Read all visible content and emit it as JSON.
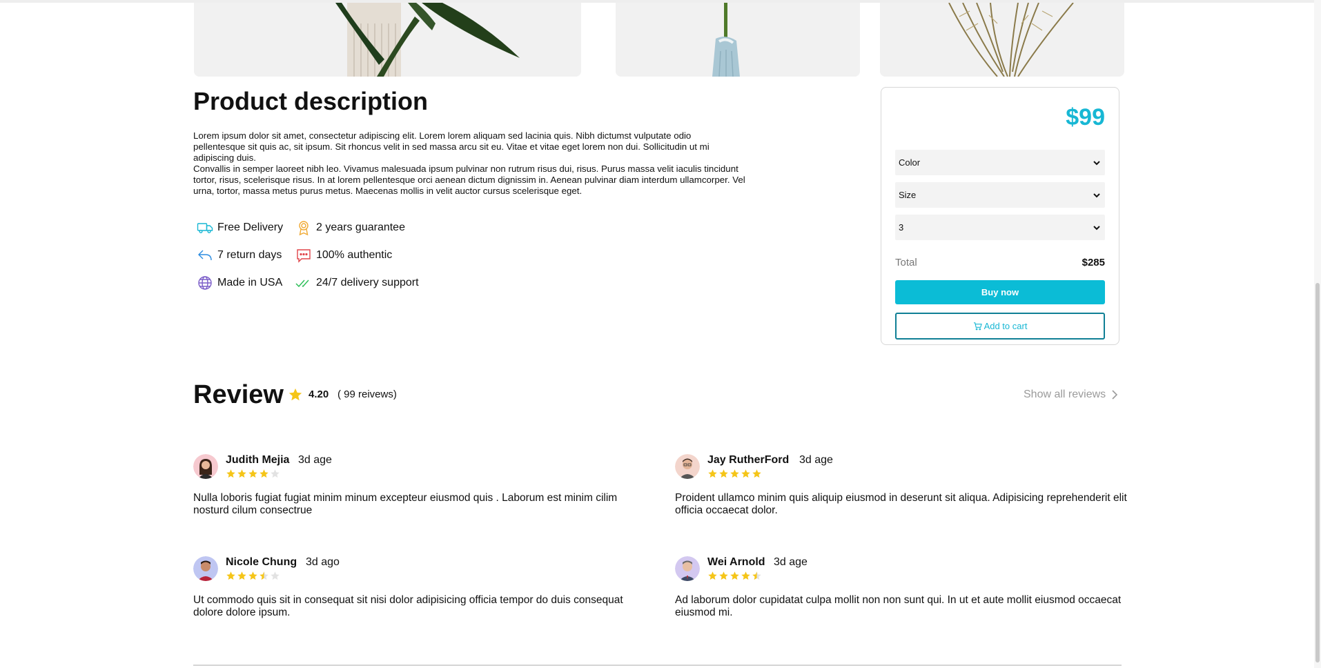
{
  "description": {
    "title": "Product description",
    "paragraph1": "Lorem ipsum dolor sit amet, consectetur adipiscing elit. Lorem lorem aliquam sed lacinia quis. Nibh dictumst vulputate odio pellentesque sit quis ac, sit ipsum. Sit rhoncus velit in sed massa arcu sit eu. Vitae et vitae eget lorem non dui. Sollicitudin ut mi adipiscing duis.",
    "paragraph2": "Convallis in semper laoreet nibh leo. Vivamus malesuada ipsum pulvinar non rutrum risus dui, risus. Purus massa velit iaculis tincidunt tortor, risus, scelerisque risus. In at lorem pellentesque orci aenean dictum dignissim in. Aenean pulvinar diam interdum ullamcorper. Vel urna, tortor, massa metus purus metus. Maecenas mollis in velit auctor cursus scelerisque eget."
  },
  "features": [
    {
      "label": "Free Delivery",
      "icon": "truck-icon",
      "color": "#17b7d4"
    },
    {
      "label": "2 years guarantee",
      "icon": "award-icon",
      "color": "#f0a830"
    },
    {
      "label": "7 return days",
      "icon": "return-arrow-icon",
      "color": "#2a8be0"
    },
    {
      "label": "100% authentic",
      "icon": "chat-icon",
      "color": "#e0454a"
    },
    {
      "label": "Made in USA",
      "icon": "globe-icon",
      "color": "#7a5cc8"
    },
    {
      "label": "24/7 delivery support",
      "icon": "double-check-icon",
      "color": "#2fbf5a"
    }
  ],
  "buybox": {
    "price": "$99",
    "color_select": "Color",
    "size_select": "Size",
    "quantity_select": "3",
    "total_label": "Total",
    "total_value": "$285",
    "buy_label": "Buy now",
    "cart_label": "Add to cart",
    "accent": "#17b7d4"
  },
  "reviews_section": {
    "title": "Review",
    "rating": "4.20",
    "count": "( 99 reivews)",
    "show_all": "Show all reviews"
  },
  "reviews": [
    {
      "name": "Judith Mejia",
      "time": "3d age",
      "stars": 4,
      "text": "Nulla loboris fugiat fugiat minim minum excepteur eiusmod quis . Laborum est minim cilim nosturd cilum consectrue"
    },
    {
      "name": "Jay RutherFord",
      "time": "3d age",
      "stars": 5,
      "text": "Proident ullamco minim quis aliquip eiusmod in deserunt sit aliqua. Adipisicing reprehenderit elit officia occaecat dolor."
    },
    {
      "name": "Nicole Chung",
      "time": "3d ago",
      "stars": 3.5,
      "text": "Ut commodo quis sit in consequat sit nisi dolor adipisicing officia tempor do duis consequat dolore dolore ipsum."
    },
    {
      "name": "Wei Arnold",
      "time": "3d age",
      "stars": 4.5,
      "text": "Ad laborum dolor cupidatat culpa mollit non non sunt qui. In ut et aute mollit eiusmod occaecat eiusmod mi."
    }
  ]
}
